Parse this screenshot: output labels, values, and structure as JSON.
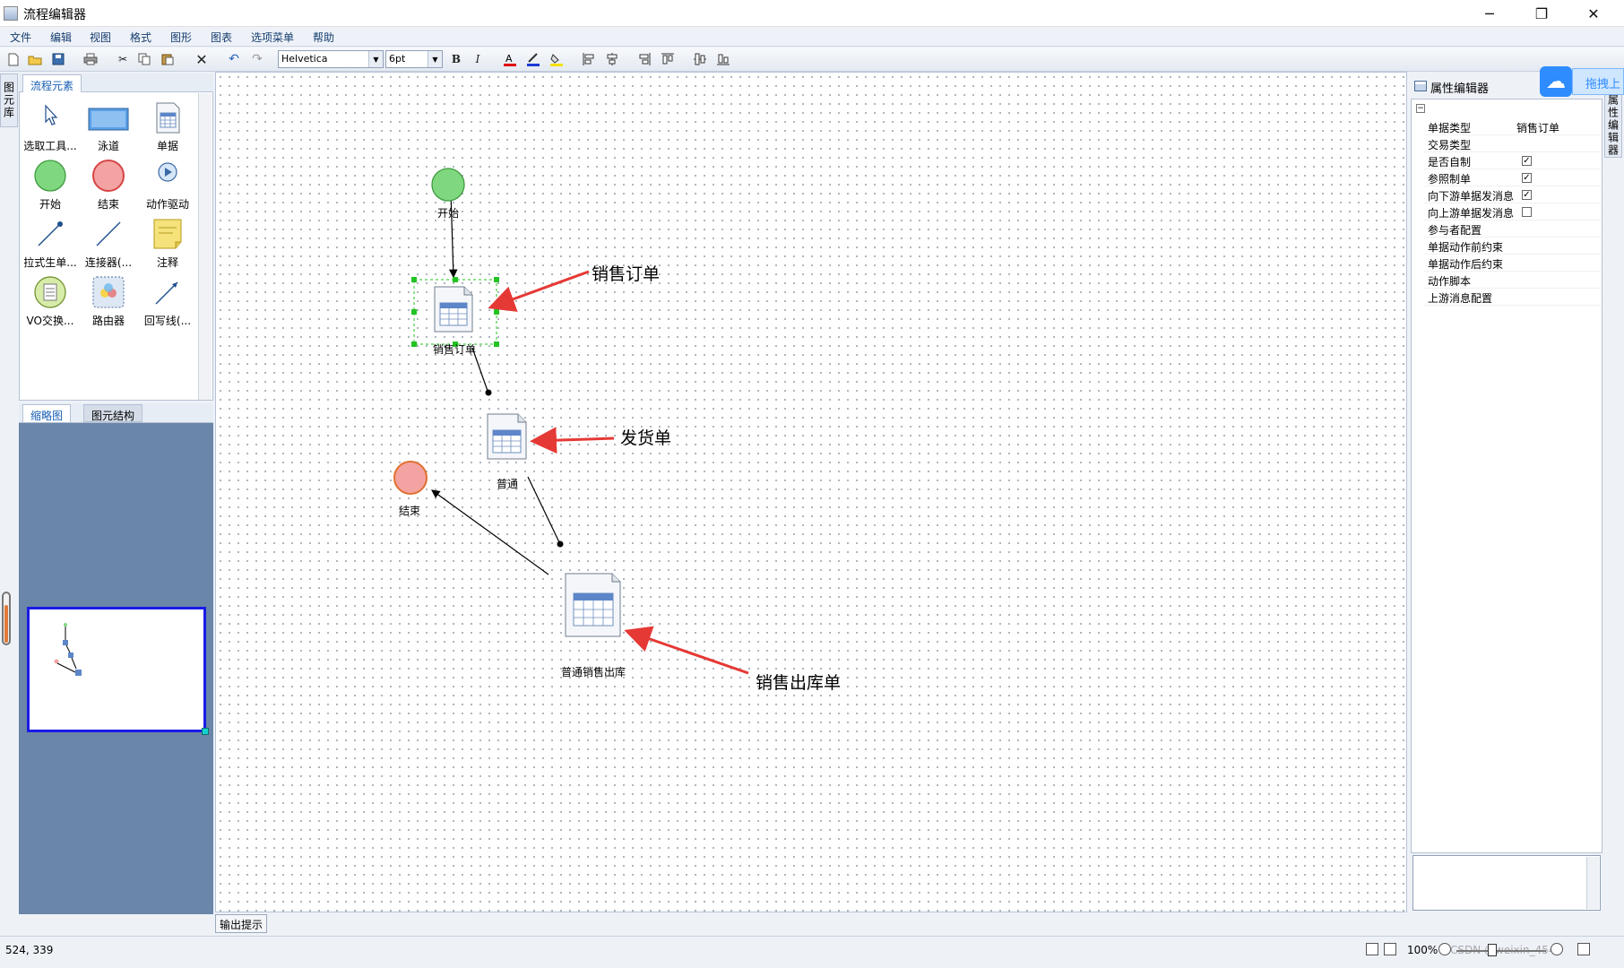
{
  "window": {
    "title": "流程编辑器",
    "minimize_glyph": "─",
    "maximize_glyph": "❐",
    "close_glyph": "✕"
  },
  "menu": [
    "文件",
    "编辑",
    "视图",
    "格式",
    "图形",
    "图表",
    "选项菜单",
    "帮助"
  ],
  "toolbar": {
    "font_family": "Helvetica",
    "font_size": "6pt",
    "bold": "B",
    "italic": "I"
  },
  "left_vertical_tab": "图元库",
  "palette": {
    "tab": "流程元素",
    "items": [
      {
        "label": "选取工具..."
      },
      {
        "label": "泳道"
      },
      {
        "label": "单据"
      },
      {
        "label": "开始"
      },
      {
        "label": "结束"
      },
      {
        "label": "动作驱动"
      },
      {
        "label": "拉式生单..."
      },
      {
        "label": "连接器(..."
      },
      {
        "label": "注释"
      },
      {
        "label": "VO交换..."
      },
      {
        "label": "路由器"
      },
      {
        "label": "回写线(..."
      }
    ]
  },
  "overview": {
    "tabs": [
      "缩略图",
      "图元结构"
    ]
  },
  "canvas": {
    "nodes": {
      "start": "开始",
      "sales_order": "销售订单",
      "delivery": "普通",
      "end": "结束",
      "outbound": "普通销售出库"
    },
    "callouts": {
      "sales_order": "销售订单",
      "delivery": "发货单",
      "outbound": "销售出库单"
    },
    "output_tab": "输出提示"
  },
  "properties": {
    "title": "属性编辑器",
    "rows": [
      {
        "key": "单据类型",
        "value": "销售订单"
      },
      {
        "key": "交易类型",
        "value": ""
      },
      {
        "key": "是否自制",
        "checkbox": true
      },
      {
        "key": "参照制单",
        "checkbox": true
      },
      {
        "key": "向下游单据发消息",
        "checkbox": true
      },
      {
        "key": "向上游单据发消息",
        "checkbox": false
      },
      {
        "key": "参与者配置",
        "value": ""
      },
      {
        "key": "单据动作前约束",
        "value": ""
      },
      {
        "key": "单据动作后约束",
        "value": ""
      },
      {
        "key": "动作脚本",
        "value": ""
      },
      {
        "key": "上游消息配置",
        "value": ""
      }
    ]
  },
  "right_vertical_tab": "属性编辑器",
  "cloud": {
    "drag_label": "拖拽上"
  },
  "status": {
    "coords": "524, 339",
    "zoom": "100%",
    "watermark": "CSDN @weixin_4543"
  },
  "colors": {
    "accent": "#1a5fb4",
    "callout_arrow": "#e53935",
    "selection": "#22c322",
    "start_fill": "#7fd87f",
    "end_fill": "#f4a3a3",
    "overview_bg": "#6a86a8"
  }
}
